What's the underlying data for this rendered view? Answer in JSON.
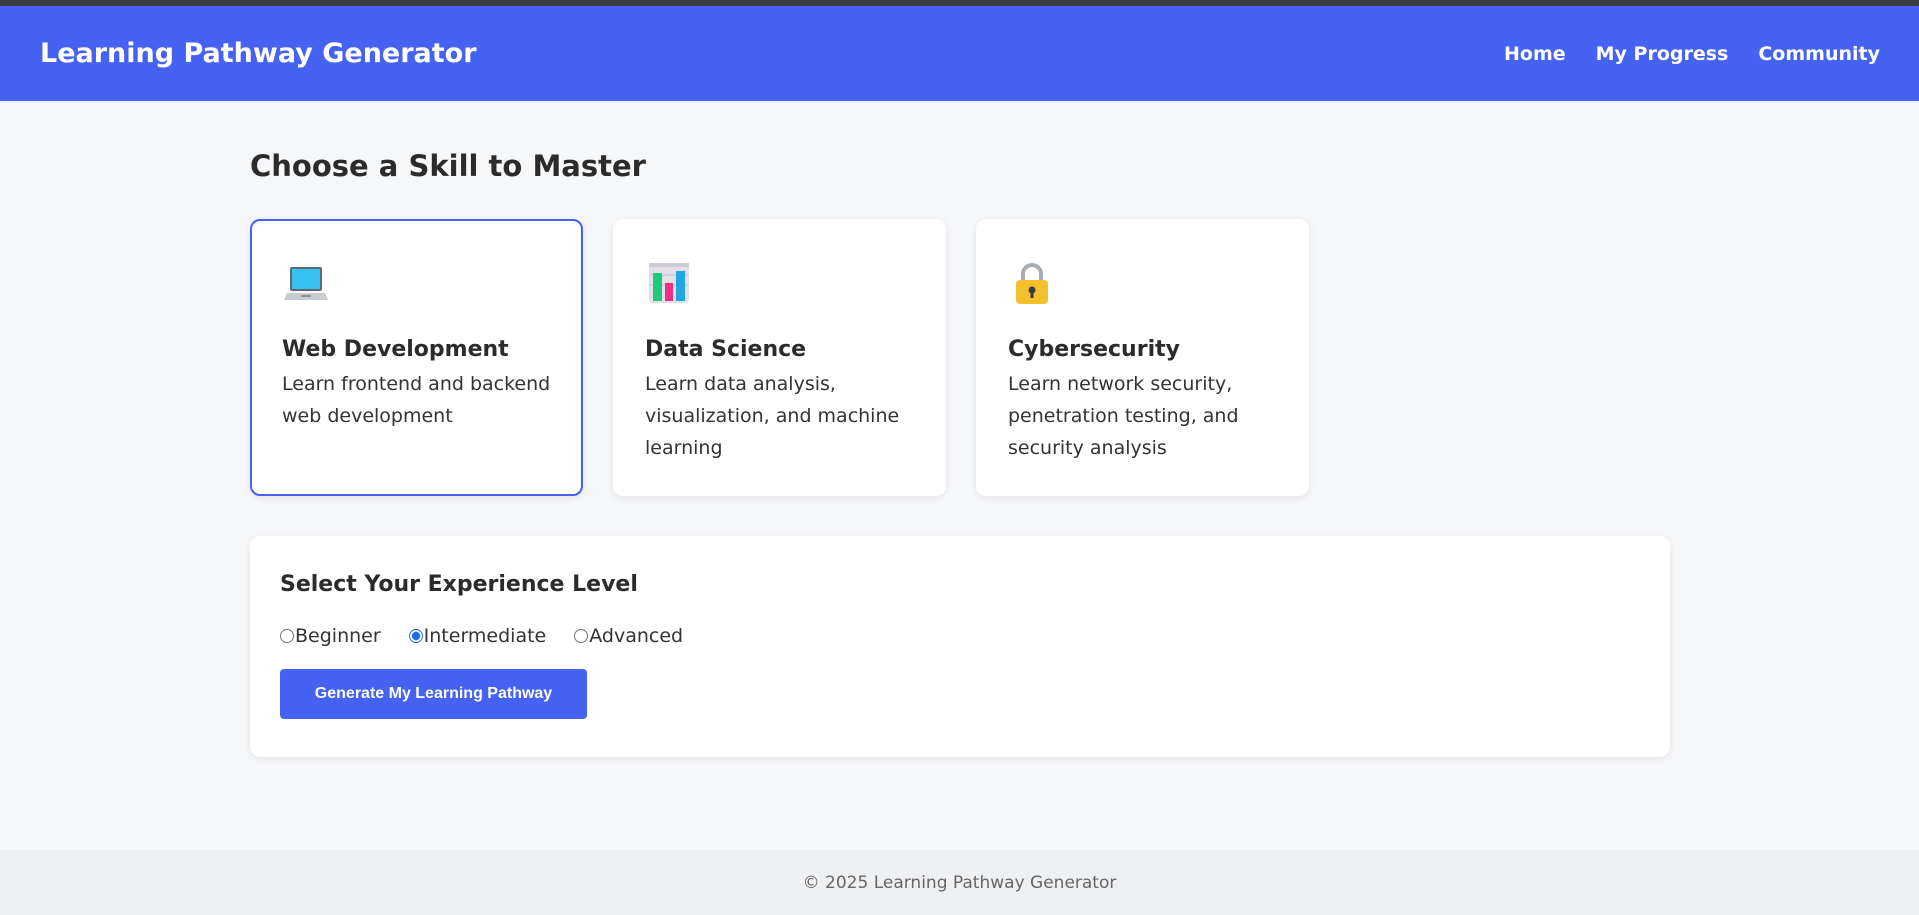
{
  "header": {
    "brand": "Learning Pathway Generator",
    "nav": [
      "Home",
      "My Progress",
      "Community"
    ]
  },
  "main": {
    "title": "Choose a Skill to Master",
    "skills": [
      {
        "icon": "laptop-icon",
        "title": "Web Development",
        "description": "Learn frontend and backend web development",
        "selected": true
      },
      {
        "icon": "bar-chart-icon",
        "title": "Data Science",
        "description": "Learn data analysis, visualization, and machine learning",
        "selected": false
      },
      {
        "icon": "lock-icon",
        "title": "Cybersecurity",
        "description": "Learn network security, penetration testing, and security analysis",
        "selected": false
      }
    ],
    "experience": {
      "title": "Select Your Experience Level",
      "options": [
        "Beginner",
        "Intermediate",
        "Advanced"
      ],
      "selected": "Intermediate",
      "button": "Generate My Learning Pathway"
    }
  },
  "footer": {
    "text": "© 2025 Learning Pathway Generator"
  },
  "colors": {
    "accent": "#4562f2",
    "background": "#f6f7f9"
  }
}
